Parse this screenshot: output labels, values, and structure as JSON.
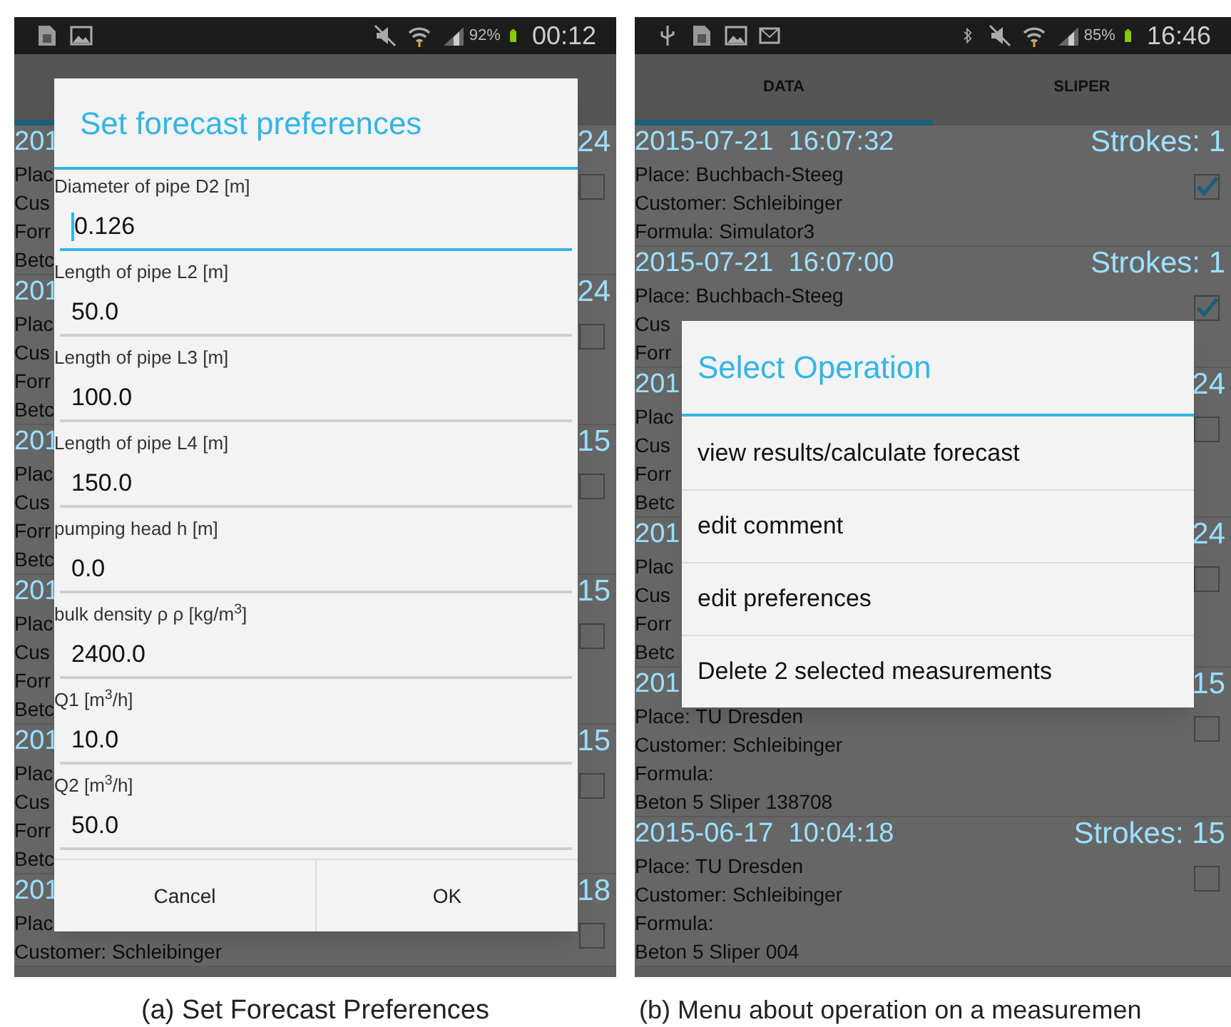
{
  "left_screen": {
    "status_bar": {
      "battery": "92%",
      "time": "00:12"
    },
    "list": [
      {
        "date": "201",
        "strokes": "24",
        "lines": [
          "Plac",
          "Cus",
          "Forr",
          "Betc"
        ],
        "checked": false
      },
      {
        "date": "201",
        "strokes": "24",
        "lines": [
          "Plac",
          "Cus",
          "Forr",
          "Betc"
        ],
        "checked": false
      },
      {
        "date": "201",
        "strokes": "15",
        "lines": [
          "Plac",
          "Cus",
          "Forr",
          "Betc"
        ],
        "checked": false
      },
      {
        "date": "201",
        "strokes": "15",
        "lines": [
          "Plac",
          "Cus",
          "Forr",
          "Betc"
        ],
        "checked": false
      },
      {
        "date": "201",
        "strokes": "15",
        "lines": [
          "Plac",
          "Cus",
          "Forr",
          "Betc"
        ],
        "checked": false
      },
      {
        "date": "201",
        "strokes": "18",
        "lines": [
          "Plac",
          "Customer: Schleibinger"
        ],
        "checked": false
      }
    ],
    "dialog": {
      "title": "Set forecast preferences",
      "fields": [
        {
          "label": "Diameter of pipe D2 [m]",
          "value": "0.126",
          "focused": true
        },
        {
          "label": "Length of pipe L2 [m]",
          "value": "50.0",
          "focused": false
        },
        {
          "label": "Length of pipe L3 [m]",
          "value": "100.0",
          "focused": false
        },
        {
          "label": "Length of pipe L4 [m]",
          "value": "150.0",
          "focused": false
        },
        {
          "label": "pumping head h [m]",
          "value": "0.0",
          "focused": false
        },
        {
          "label": "bulk density ρ ρ [kg/m$^{3}$]",
          "value": "2400.0",
          "focused": false
        },
        {
          "label": "Q1 [m$^{3}$/h]",
          "value": "10.0",
          "focused": false
        },
        {
          "label": "Q2 [m$^{3}$/h]",
          "value": "50.0",
          "focused": false
        }
      ],
      "buttons": [
        "Cancel",
        "OK"
      ]
    },
    "caption": "(a) Set Forecast Preferences"
  },
  "right_screen": {
    "status_bar": {
      "battery": "85%",
      "time": "16:46"
    },
    "tabs": [
      {
        "label": "DATA",
        "selected": true
      },
      {
        "label": "SLIPER",
        "selected": false
      }
    ],
    "list": [
      {
        "date": "2015-07-21  16:07:32",
        "strokes": "Strokes: 1",
        "lines": [
          "Place: Buchbach-Steeg",
          "Customer: Schleibinger",
          "Formula: Simulator3"
        ],
        "checked": true
      },
      {
        "date": "2015-07-21  16:07:00",
        "strokes": "Strokes: 1",
        "lines": [
          "Place: Buchbach-Steeg",
          "Cus",
          "Forr"
        ],
        "checked": true
      },
      {
        "date": "201",
        "strokes": "24",
        "lines": [
          "Plac",
          "Cus",
          "Forr",
          "Betc"
        ],
        "checked": false
      },
      {
        "date": "201",
        "strokes": "24",
        "lines": [
          "Plac",
          "Cus",
          "Forr",
          "Betc"
        ],
        "checked": false
      },
      {
        "date": "201",
        "strokes": "15",
        "lines": [
          "Place: TU Dresden",
          "Customer: Schleibinger",
          "Formula:",
          "Beton 5 Sliper 138708"
        ],
        "checked": false
      },
      {
        "date": "2015-06-17  10:04:18",
        "strokes": "Strokes: 15",
        "lines": [
          "Place: TU Dresden",
          "Customer: Schleibinger",
          "Formula:",
          "Beton 5 Sliper 004"
        ],
        "checked": false
      }
    ],
    "dialog": {
      "title": "Select Operation",
      "items": [
        "view results/calculate forecast",
        "edit comment",
        "edit preferences",
        "Delete 2 selected measurements"
      ]
    },
    "caption": "(b) Menu about operation on a measuremen"
  }
}
